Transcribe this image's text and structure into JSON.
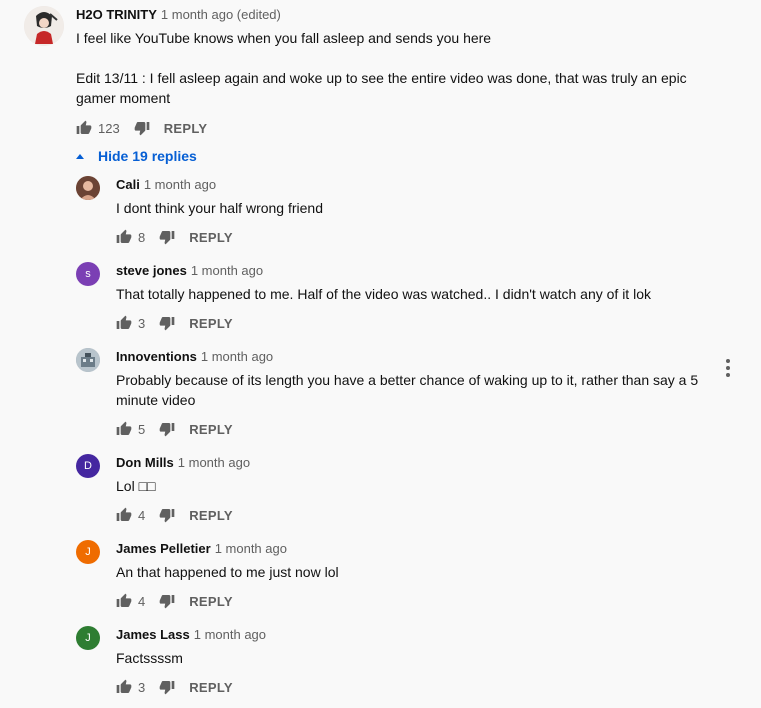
{
  "top_comment": {
    "author": "H2O TRINITY",
    "time": "1 month ago (edited)",
    "line1": "I feel like YouTube knows when you fall asleep and sends you here",
    "line2": "Edit 13/11 : I fell asleep again and woke up to see the entire video was done, that was truly an epic",
    "line3": "gamer moment",
    "likes": "123",
    "reply_label": "REPLY"
  },
  "hide_replies_label": "Hide 19 replies",
  "replies": [
    {
      "author": "Cali",
      "time": "1 month ago",
      "text": "I dont think your half wrong friend",
      "likes": "8",
      "reply_label": "REPLY",
      "avatar_letter": "",
      "avatar_color": "#8a5a44"
    },
    {
      "author": "steve jones",
      "time": "1 month ago",
      "text": "That totally happened to me. Half of the video was watched.. I didn't watch any of it lok",
      "likes": "3",
      "reply_label": "REPLY",
      "avatar_letter": "s",
      "avatar_color": "#7b3fb4"
    },
    {
      "author": "Innoventions",
      "time": "1 month ago",
      "text": "Probably because of its length you have a better chance of waking up to it, rather than say a 5",
      "text2": "minute video",
      "likes": "5",
      "reply_label": "REPLY",
      "avatar_letter": "",
      "avatar_color": "#9aa7b0"
    },
    {
      "author": "Don Mills",
      "time": "1 month ago",
      "text": "Lol □□",
      "likes": "4",
      "reply_label": "REPLY",
      "avatar_letter": "D",
      "avatar_color": "#4527a0"
    },
    {
      "author": "James Pelletier",
      "time": "1 month ago",
      "text": "An that happened to me just now  lol",
      "likes": "4",
      "reply_label": "REPLY",
      "avatar_letter": "J",
      "avatar_color": "#ef6c00"
    },
    {
      "author": "James Lass",
      "time": "1 month ago",
      "text": "Factssssm",
      "likes": "3",
      "reply_label": "REPLY",
      "avatar_letter": "J",
      "avatar_color": "#2e7d32"
    }
  ],
  "icons": {
    "like": "thumbs-up-icon",
    "dislike": "thumbs-down-icon",
    "more": "more-vert-icon",
    "hide": "caret-up-icon"
  }
}
